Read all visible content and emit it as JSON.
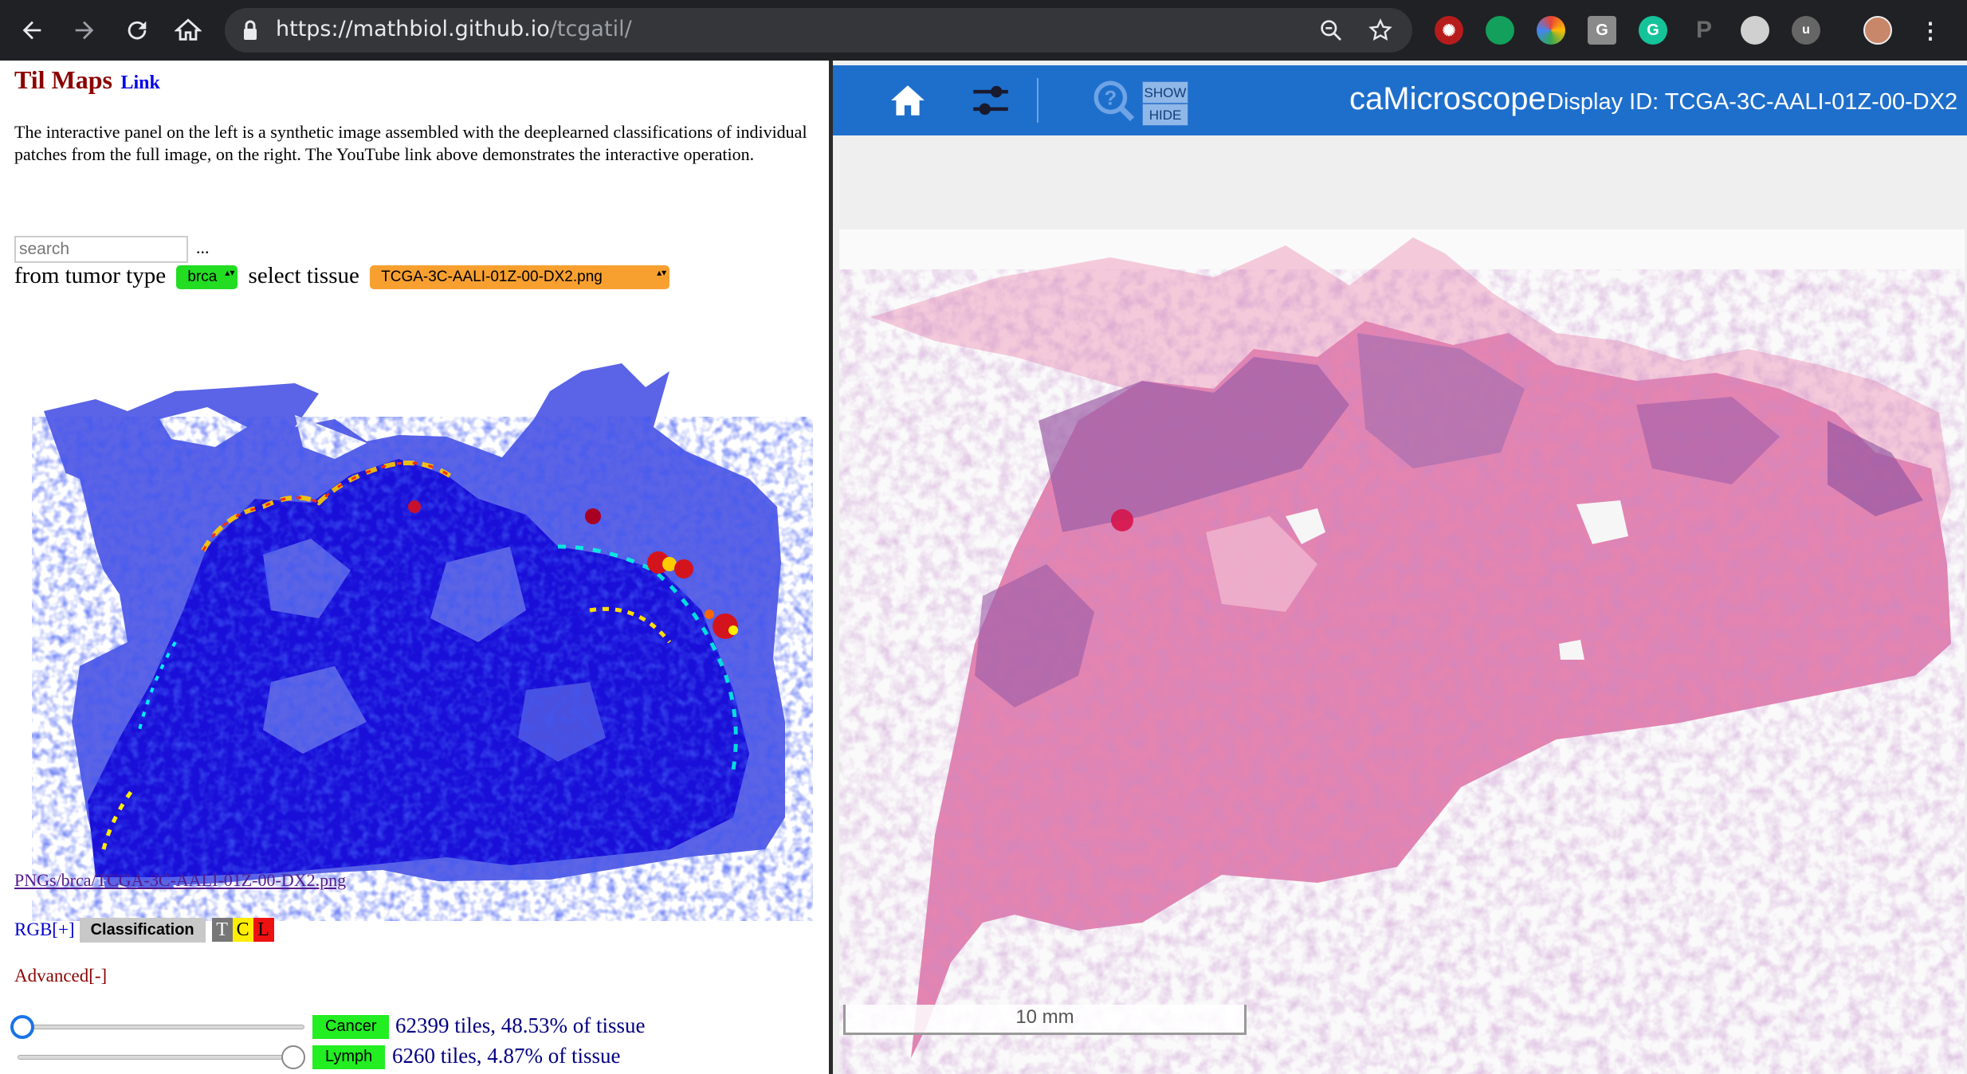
{
  "browser": {
    "url_host": "https://mathbiol.github.io",
    "url_path": "/tcgatil/"
  },
  "page": {
    "title": "Til Maps",
    "link_label": "Link",
    "description": "The interactive panel on the left is a synthetic image assembled with the deeplearned classifications of individual patches from the full image, on the right. The YouTube link above demonstrates the interactive operation.",
    "search_placeholder": "search",
    "ellipsis": "...",
    "from_tumor_type_label": "from tumor type",
    "tumor_type_value": "brca",
    "select_tissue_label": "select tissue",
    "tissue_value": "TCGA-3C-AALI-01Z-00-DX2.png",
    "png_link": "PNGs/brca/TCGA-3C-AALI-01Z-00-DX2.png",
    "rgb_label": "RGB[+]",
    "classification_label": "Classification",
    "tcl": [
      "T",
      "C",
      "L"
    ],
    "advanced_label": "Advanced[-]",
    "cancer": {
      "label": "Cancer",
      "stats": "62399 tiles, 48.53% of tissue",
      "slider_value": 0
    },
    "lymph": {
      "label": "Lymph",
      "stats": "6260 tiles, 4.87% of tissue",
      "slider_value": 100
    }
  },
  "camicroscope": {
    "show_label": "SHOW",
    "hide_label": "HIDE",
    "title": "caMicroscope",
    "display_id": "Display ID: TCGA-3C-AALI-01Z-00-DX2",
    "scale_label": "10 mm"
  },
  "icons": [
    "back-icon",
    "forward-icon",
    "reload-icon",
    "home-icon",
    "lock-icon",
    "zoom-icon",
    "star-icon",
    "sliders-icon",
    "help-icon"
  ],
  "colors": {
    "chrome_bg": "#202124",
    "camic_bar": "#1e6fcc",
    "title_red": "#8b0000",
    "button_green": "#22ee22",
    "select_orange": "#f7a030"
  }
}
